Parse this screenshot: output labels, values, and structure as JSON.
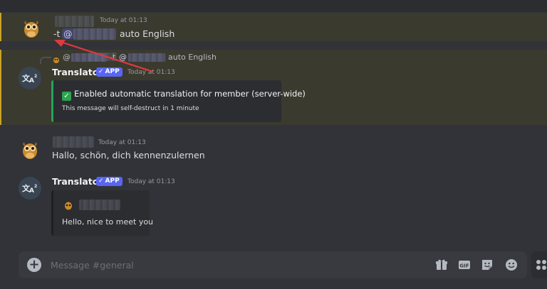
{
  "messages": {
    "first": {
      "timestamp": "Today at 01:13",
      "command": "-t",
      "mention_at": "@",
      "args": "auto English"
    },
    "bot_reply": {
      "reply_preview": {
        "at": "@",
        "command": "-t",
        "mention_at": "@",
        "args": "auto English"
      },
      "username": "Translator",
      "badge": "APP",
      "timestamp": "Today at 01:13",
      "embed_title": "Enabled automatic translation for member (server-wide)",
      "embed_note": "This message will self-destruct in 1 minute"
    },
    "third": {
      "timestamp": "Today at 01:13",
      "text": "Hallo, schön, dich kennenzulernen"
    },
    "bot_translation": {
      "username": "Translator",
      "badge": "APP",
      "timestamp": "Today at 01:13",
      "embed_text": "Hello, nice to meet you"
    }
  },
  "composer": {
    "placeholder": "Message #general"
  },
  "icons": {
    "composer_plus": "plus-circle-icon",
    "gift": "gift-icon",
    "gif": "gif-icon",
    "sticker": "sticker-icon",
    "emoji": "emoji-icon",
    "bot_avatar": "translate-icon",
    "user_avatar": "owl-icon"
  },
  "colors": {
    "background": "#313338",
    "highlight": "#3b3a2f",
    "mention": "#5865f2",
    "embed_success": "#23a55a",
    "annotation_arrow": "#e0393e"
  }
}
